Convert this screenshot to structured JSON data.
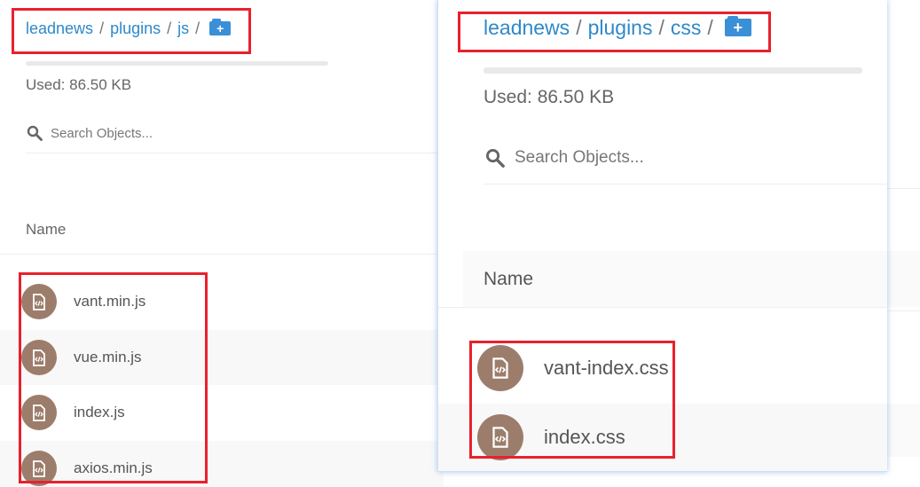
{
  "left_pane": {
    "breadcrumb": [
      "leadnews",
      "plugins",
      "js"
    ],
    "separator": "/",
    "add_folder_symbol": "+",
    "used_label": "Used: 86.50 KB",
    "search_placeholder": "Search Objects...",
    "column_name": "Name",
    "files": [
      {
        "name": "vant.min.js",
        "icon": "code-file-icon"
      },
      {
        "name": "vue.min.js",
        "icon": "code-file-icon"
      },
      {
        "name": "index.js",
        "icon": "code-file-icon"
      },
      {
        "name": "axios.min.js",
        "icon": "code-file-icon"
      }
    ]
  },
  "right_pane": {
    "breadcrumb": [
      "leadnews",
      "plugins",
      "css"
    ],
    "separator": "/",
    "add_folder_symbol": "+",
    "used_label": "Used: 86.50 KB",
    "search_placeholder": "Search Objects...",
    "column_name": "Name",
    "files": [
      {
        "name": "vant-index.css",
        "icon": "code-file-icon"
      },
      {
        "name": "index.css",
        "icon": "code-file-icon"
      }
    ]
  },
  "colors": {
    "link": "#2e89c9",
    "add_folder_button": "#3b8fd6",
    "file_icon_bg": "#9c7d6b",
    "annotation_box": "#e8212d"
  }
}
